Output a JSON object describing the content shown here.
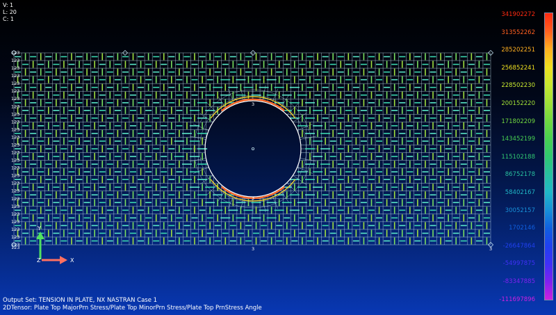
{
  "view_info": {
    "line1": "V: 1",
    "line2": "L: 20",
    "line3": "C: 1"
  },
  "output_info": {
    "line1": "Output Set: TENSION IN PLATE, NX NASTRAN Case 1",
    "line2": "2DTensor: Plate Top MajorPrn Stress/Plate Top MinorPrn Stress/Plate Top PrnStress Angle"
  },
  "axis_triad": {
    "x_label": "X",
    "y_label": "Y",
    "z_label": "Z"
  },
  "node_labels": {
    "edge": "123",
    "mid": "3"
  },
  "legend": {
    "labels": [
      "341902272",
      "313552262",
      "285202251",
      "256852241",
      "228502230",
      "200152220",
      "171802209",
      "143452199",
      "115102188",
      "86752178",
      "58402167",
      "30052157",
      "1702146",
      "-26647864",
      "-54997875",
      "-83347885",
      "-111697896"
    ],
    "colors": [
      "#ff2a10",
      "#ff6020",
      "#ffb020",
      "#f0e020",
      "#c8e830",
      "#a0e038",
      "#70d840",
      "#48d050",
      "#30c870",
      "#28c0a0",
      "#20b8c8",
      "#1890d8",
      "#1060e0",
      "#2040f0",
      "#4030f8",
      "#8020f0",
      "#d020e0"
    ]
  },
  "colors": {
    "mesh": "#c8eaf4",
    "hole_edge": "#ffffff"
  }
}
